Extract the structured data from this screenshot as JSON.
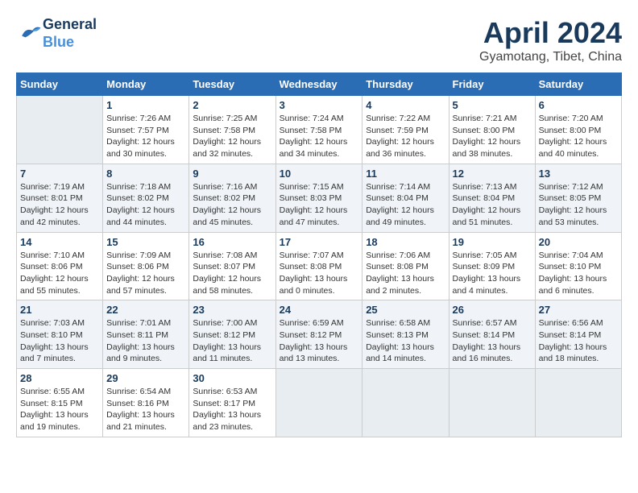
{
  "header": {
    "logo_line1": "General",
    "logo_line2": "Blue",
    "month": "April 2024",
    "location": "Gyamotang, Tibet, China"
  },
  "days_of_week": [
    "Sunday",
    "Monday",
    "Tuesday",
    "Wednesday",
    "Thursday",
    "Friday",
    "Saturday"
  ],
  "weeks": [
    [
      {
        "day": "",
        "info": ""
      },
      {
        "day": "1",
        "info": "Sunrise: 7:26 AM\nSunset: 7:57 PM\nDaylight: 12 hours\nand 30 minutes."
      },
      {
        "day": "2",
        "info": "Sunrise: 7:25 AM\nSunset: 7:58 PM\nDaylight: 12 hours\nand 32 minutes."
      },
      {
        "day": "3",
        "info": "Sunrise: 7:24 AM\nSunset: 7:58 PM\nDaylight: 12 hours\nand 34 minutes."
      },
      {
        "day": "4",
        "info": "Sunrise: 7:22 AM\nSunset: 7:59 PM\nDaylight: 12 hours\nand 36 minutes."
      },
      {
        "day": "5",
        "info": "Sunrise: 7:21 AM\nSunset: 8:00 PM\nDaylight: 12 hours\nand 38 minutes."
      },
      {
        "day": "6",
        "info": "Sunrise: 7:20 AM\nSunset: 8:00 PM\nDaylight: 12 hours\nand 40 minutes."
      }
    ],
    [
      {
        "day": "7",
        "info": "Sunrise: 7:19 AM\nSunset: 8:01 PM\nDaylight: 12 hours\nand 42 minutes."
      },
      {
        "day": "8",
        "info": "Sunrise: 7:18 AM\nSunset: 8:02 PM\nDaylight: 12 hours\nand 44 minutes."
      },
      {
        "day": "9",
        "info": "Sunrise: 7:16 AM\nSunset: 8:02 PM\nDaylight: 12 hours\nand 45 minutes."
      },
      {
        "day": "10",
        "info": "Sunrise: 7:15 AM\nSunset: 8:03 PM\nDaylight: 12 hours\nand 47 minutes."
      },
      {
        "day": "11",
        "info": "Sunrise: 7:14 AM\nSunset: 8:04 PM\nDaylight: 12 hours\nand 49 minutes."
      },
      {
        "day": "12",
        "info": "Sunrise: 7:13 AM\nSunset: 8:04 PM\nDaylight: 12 hours\nand 51 minutes."
      },
      {
        "day": "13",
        "info": "Sunrise: 7:12 AM\nSunset: 8:05 PM\nDaylight: 12 hours\nand 53 minutes."
      }
    ],
    [
      {
        "day": "14",
        "info": "Sunrise: 7:10 AM\nSunset: 8:06 PM\nDaylight: 12 hours\nand 55 minutes."
      },
      {
        "day": "15",
        "info": "Sunrise: 7:09 AM\nSunset: 8:06 PM\nDaylight: 12 hours\nand 57 minutes."
      },
      {
        "day": "16",
        "info": "Sunrise: 7:08 AM\nSunset: 8:07 PM\nDaylight: 12 hours\nand 58 minutes."
      },
      {
        "day": "17",
        "info": "Sunrise: 7:07 AM\nSunset: 8:08 PM\nDaylight: 13 hours\nand 0 minutes."
      },
      {
        "day": "18",
        "info": "Sunrise: 7:06 AM\nSunset: 8:08 PM\nDaylight: 13 hours\nand 2 minutes."
      },
      {
        "day": "19",
        "info": "Sunrise: 7:05 AM\nSunset: 8:09 PM\nDaylight: 13 hours\nand 4 minutes."
      },
      {
        "day": "20",
        "info": "Sunrise: 7:04 AM\nSunset: 8:10 PM\nDaylight: 13 hours\nand 6 minutes."
      }
    ],
    [
      {
        "day": "21",
        "info": "Sunrise: 7:03 AM\nSunset: 8:10 PM\nDaylight: 13 hours\nand 7 minutes."
      },
      {
        "day": "22",
        "info": "Sunrise: 7:01 AM\nSunset: 8:11 PM\nDaylight: 13 hours\nand 9 minutes."
      },
      {
        "day": "23",
        "info": "Sunrise: 7:00 AM\nSunset: 8:12 PM\nDaylight: 13 hours\nand 11 minutes."
      },
      {
        "day": "24",
        "info": "Sunrise: 6:59 AM\nSunset: 8:12 PM\nDaylight: 13 hours\nand 13 minutes."
      },
      {
        "day": "25",
        "info": "Sunrise: 6:58 AM\nSunset: 8:13 PM\nDaylight: 13 hours\nand 14 minutes."
      },
      {
        "day": "26",
        "info": "Sunrise: 6:57 AM\nSunset: 8:14 PM\nDaylight: 13 hours\nand 16 minutes."
      },
      {
        "day": "27",
        "info": "Sunrise: 6:56 AM\nSunset: 8:14 PM\nDaylight: 13 hours\nand 18 minutes."
      }
    ],
    [
      {
        "day": "28",
        "info": "Sunrise: 6:55 AM\nSunset: 8:15 PM\nDaylight: 13 hours\nand 19 minutes."
      },
      {
        "day": "29",
        "info": "Sunrise: 6:54 AM\nSunset: 8:16 PM\nDaylight: 13 hours\nand 21 minutes."
      },
      {
        "day": "30",
        "info": "Sunrise: 6:53 AM\nSunset: 8:17 PM\nDaylight: 13 hours\nand 23 minutes."
      },
      {
        "day": "",
        "info": ""
      },
      {
        "day": "",
        "info": ""
      },
      {
        "day": "",
        "info": ""
      },
      {
        "day": "",
        "info": ""
      }
    ]
  ]
}
